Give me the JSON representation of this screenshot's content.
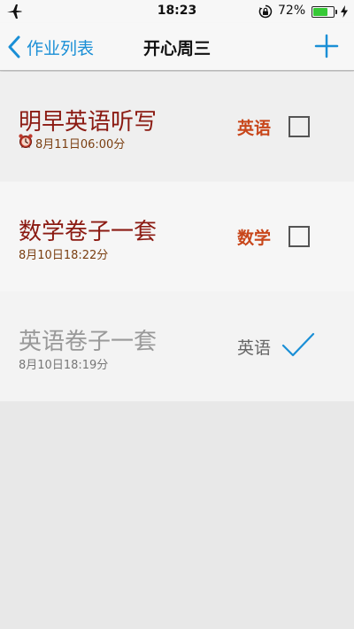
{
  "status_bar": {
    "time": "18:23",
    "battery_percent": "72%",
    "battery_level": 0.72,
    "icons": [
      "airplane-icon",
      "rotation-lock-icon",
      "battery-icon",
      "charging-icon"
    ]
  },
  "nav": {
    "back_label": "作业列表",
    "title": "开心周三",
    "add_icon": "plus-icon"
  },
  "items": [
    {
      "title": "明早英语听写",
      "time": "8月11日06:00分",
      "subject": "英语",
      "checked": false,
      "has_alarm": true
    },
    {
      "title": "数学卷子一套",
      "time": "8月10日18:22分",
      "subject": "数学",
      "checked": false,
      "has_alarm": false
    },
    {
      "title": "英语卷子一套",
      "time": "8月10日18:19分",
      "subject": "英语",
      "checked": true,
      "has_alarm": false
    }
  ],
  "colors": {
    "accent": "#1a8fd6",
    "title_active": "#8b1a12",
    "subject_active": "#c8461a",
    "done_text": "#999999",
    "battery_fill": "#36c936"
  }
}
